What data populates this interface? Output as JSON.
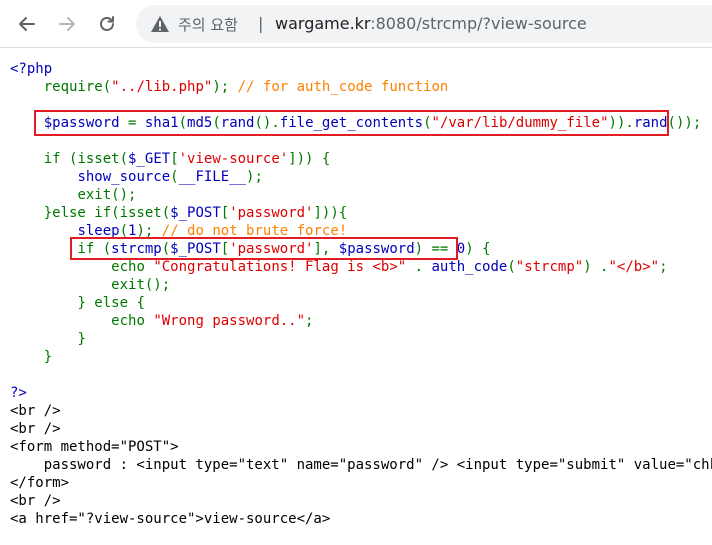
{
  "browser": {
    "security_warning": "주의 요함",
    "separator": "|",
    "url_host": "wargame.kr",
    "url_rest": ":8080/strcmp/?view-source"
  },
  "code_lines": [
    [
      {
        "t": "<?php",
        "c": "php"
      }
    ],
    [
      {
        "t": "    ",
        "c": "php"
      },
      {
        "t": "require",
        "c": "kw"
      },
      {
        "t": "(",
        "c": "kw"
      },
      {
        "t": "\"../lib.php\"",
        "c": "str"
      },
      {
        "t": "); ",
        "c": "kw"
      },
      {
        "t": "// for auth_code function",
        "c": "cm"
      }
    ],
    [
      {
        "t": "",
        "c": "php"
      }
    ],
    [
      {
        "t": "    ",
        "c": "php"
      },
      {
        "t": "$password ",
        "c": "php"
      },
      {
        "t": "= ",
        "c": "kw"
      },
      {
        "t": "sha1",
        "c": "php"
      },
      {
        "t": "(",
        "c": "kw"
      },
      {
        "t": "md5",
        "c": "php"
      },
      {
        "t": "(",
        "c": "kw"
      },
      {
        "t": "rand",
        "c": "php"
      },
      {
        "t": "().",
        "c": "kw"
      },
      {
        "t": "file_get_contents",
        "c": "php"
      },
      {
        "t": "(",
        "c": "kw"
      },
      {
        "t": "\"/var/lib/dummy_file\"",
        "c": "str"
      },
      {
        "t": ")).",
        "c": "kw"
      },
      {
        "t": "rand",
        "c": "php"
      },
      {
        "t": "());",
        "c": "kw"
      }
    ],
    [
      {
        "t": "",
        "c": "php"
      }
    ],
    [
      {
        "t": "    ",
        "c": "php"
      },
      {
        "t": "if (",
        "c": "kw"
      },
      {
        "t": "isset",
        "c": "kw"
      },
      {
        "t": "(",
        "c": "kw"
      },
      {
        "t": "$_GET",
        "c": "php"
      },
      {
        "t": "[",
        "c": "kw"
      },
      {
        "t": "'view-source'",
        "c": "str"
      },
      {
        "t": "])) {",
        "c": "kw"
      }
    ],
    [
      {
        "t": "        ",
        "c": "php"
      },
      {
        "t": "show_source",
        "c": "php"
      },
      {
        "t": "(",
        "c": "kw"
      },
      {
        "t": "__FILE__",
        "c": "php"
      },
      {
        "t": ");",
        "c": "kw"
      }
    ],
    [
      {
        "t": "        ",
        "c": "php"
      },
      {
        "t": "exit();",
        "c": "kw"
      }
    ],
    [
      {
        "t": "    ",
        "c": "php"
      },
      {
        "t": "}else if(",
        "c": "kw"
      },
      {
        "t": "isset",
        "c": "kw"
      },
      {
        "t": "(",
        "c": "kw"
      },
      {
        "t": "$_POST",
        "c": "php"
      },
      {
        "t": "[",
        "c": "kw"
      },
      {
        "t": "'password'",
        "c": "str"
      },
      {
        "t": "])){",
        "c": "kw"
      }
    ],
    [
      {
        "t": "        ",
        "c": "php"
      },
      {
        "t": "sleep",
        "c": "php"
      },
      {
        "t": "(",
        "c": "kw"
      },
      {
        "t": "1",
        "c": "php"
      },
      {
        "t": "); ",
        "c": "kw"
      },
      {
        "t": "// do not brute force!",
        "c": "cm"
      }
    ],
    [
      {
        "t": "        ",
        "c": "php"
      },
      {
        "t": "if (",
        "c": "kw"
      },
      {
        "t": "strcmp",
        "c": "php"
      },
      {
        "t": "(",
        "c": "kw"
      },
      {
        "t": "$_POST",
        "c": "php"
      },
      {
        "t": "[",
        "c": "kw"
      },
      {
        "t": "'password'",
        "c": "str"
      },
      {
        "t": "], ",
        "c": "kw"
      },
      {
        "t": "$password",
        "c": "php"
      },
      {
        "t": ") == ",
        "c": "kw"
      },
      {
        "t": "0",
        "c": "php"
      },
      {
        "t": ") {",
        "c": "kw"
      }
    ],
    [
      {
        "t": "            ",
        "c": "php"
      },
      {
        "t": "echo ",
        "c": "kw"
      },
      {
        "t": "\"Congratulations! Flag is <b>\" ",
        "c": "str"
      },
      {
        "t": ". ",
        "c": "kw"
      },
      {
        "t": "auth_code",
        "c": "php"
      },
      {
        "t": "(",
        "c": "kw"
      },
      {
        "t": "\"strcmp\"",
        "c": "str"
      },
      {
        "t": ") .",
        "c": "kw"
      },
      {
        "t": "\"</b>\"",
        "c": "str"
      },
      {
        "t": ";",
        "c": "kw"
      }
    ],
    [
      {
        "t": "            ",
        "c": "php"
      },
      {
        "t": "exit();",
        "c": "kw"
      }
    ],
    [
      {
        "t": "        ",
        "c": "php"
      },
      {
        "t": "} else {",
        "c": "kw"
      }
    ],
    [
      {
        "t": "            ",
        "c": "php"
      },
      {
        "t": "echo ",
        "c": "kw"
      },
      {
        "t": "\"Wrong password..\"",
        "c": "str"
      },
      {
        "t": ";",
        "c": "kw"
      }
    ],
    [
      {
        "t": "        ",
        "c": "php"
      },
      {
        "t": "}",
        "c": "kw"
      }
    ],
    [
      {
        "t": "    ",
        "c": "php"
      },
      {
        "t": "}",
        "c": "kw"
      }
    ],
    [
      {
        "t": "",
        "c": "php"
      }
    ],
    [
      {
        "t": "?>",
        "c": "php"
      }
    ],
    [
      {
        "t": "<br />",
        "c": "hl"
      }
    ],
    [
      {
        "t": "<br />",
        "c": "hl"
      }
    ],
    [
      {
        "t": "<form method=\"POST\">",
        "c": "hl"
      }
    ],
    [
      {
        "t": "    password : <input type=\"text\" name=\"password\" /> <input type=\"submit\" value=\"chk\">",
        "c": "hl"
      }
    ],
    [
      {
        "t": "</form>",
        "c": "hl"
      }
    ],
    [
      {
        "t": "<br />",
        "c": "hl"
      }
    ],
    [
      {
        "t": "<a href=\"?view-source\">view-source</a>",
        "c": "hl"
      }
    ]
  ],
  "colors": {
    "php": "#0000bb",
    "keyword": "#007700",
    "string": "#dd0000",
    "comment": "#ff8000",
    "highlight_box": "#e31b23"
  },
  "icons": [
    "back-arrow-icon",
    "forward-arrow-icon",
    "reload-icon",
    "warning-triangle-icon"
  ]
}
